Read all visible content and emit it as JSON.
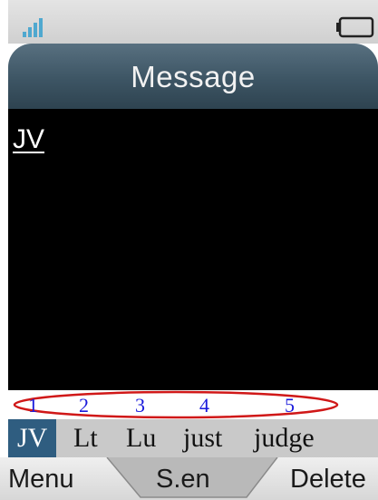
{
  "window": {
    "title": "Message"
  },
  "status": {
    "signal_icon": "signal-bars-icon",
    "battery_icon": "battery-icon"
  },
  "message": {
    "typed_text": "JV"
  },
  "candidates": {
    "indices": [
      "1",
      "2",
      "3",
      "4",
      "5"
    ],
    "words": [
      "JV",
      "Lt",
      "Lu",
      "just",
      "judge"
    ],
    "selected_index": 0,
    "highlight_color": "#2f5d80",
    "annotation_color": "#d01818"
  },
  "softkeys": {
    "left": "Menu",
    "center": "S.en",
    "right": "Delete"
  },
  "colors": {
    "title_bar": "#3d5564",
    "index_text": "#1a1adc",
    "candidate_bar": "#c9c9c9"
  }
}
